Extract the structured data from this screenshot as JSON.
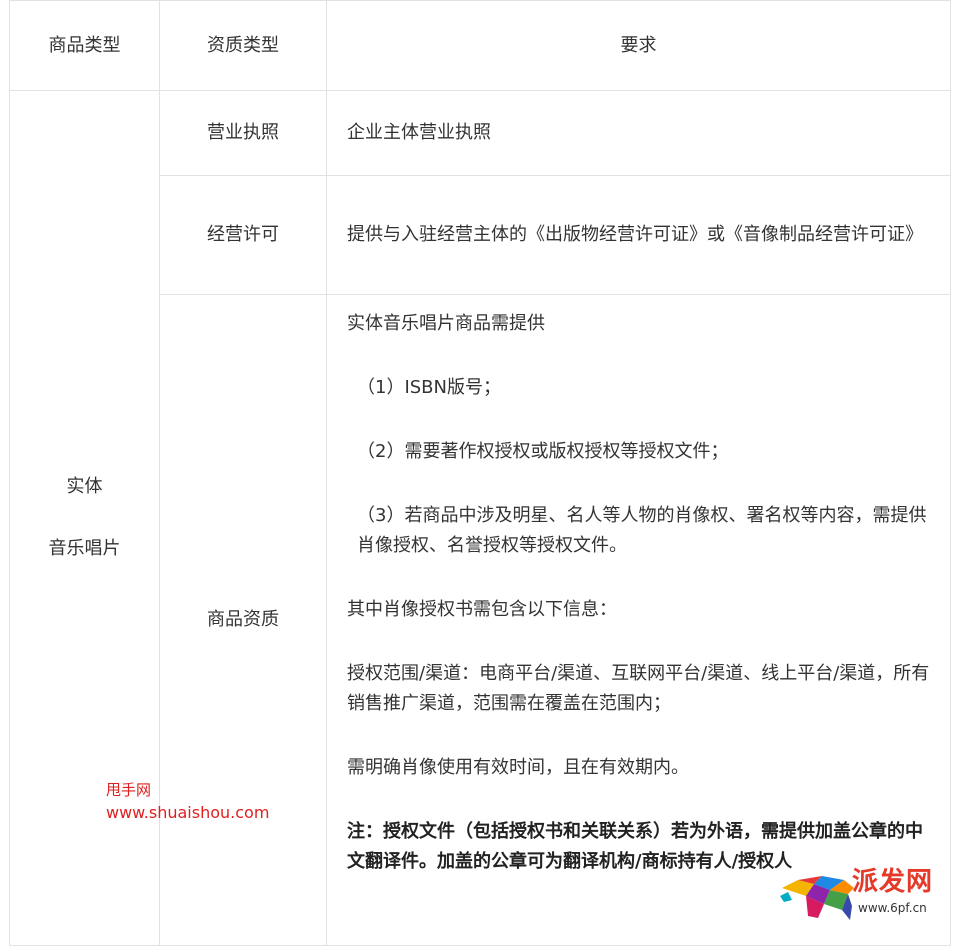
{
  "table": {
    "headers": [
      "商品类型",
      "资质类型",
      "要求"
    ],
    "category_line1": "实体",
    "category_line2": "音乐唱片",
    "rows": [
      {
        "type": "营业执照",
        "requirement": "企业主体营业执照"
      },
      {
        "type": "经营许可",
        "requirement": "提供与入驻经营主体的《出版物经营许可证》或《音像制品经营许可证》"
      },
      {
        "type": "商品资质",
        "paragraphs": [
          "实体音乐唱片商品需提供",
          "（1）ISBN版号；",
          "（2）需要著作权授权或版权授权等授权文件；",
          "（3）若商品中涉及明星、名人等人物的肖像权、署名权等内容，需提供肖像授权、名誉授权等授权文件。",
          "其中肖像授权书需包含以下信息：",
          "授权范围/渠道：电商平台/渠道、互联网平台/渠道、线上平台/渠道，所有销售推广渠道，范围需在覆盖在范围内；",
          "需明确肖像使用有效时间，且在有效期内。",
          "注：授权文件（包括授权书和关联关系）若为外语，需提供加盖公章的中文翻译件。加盖的公章可为翻译机构/商标持有人/授权人"
        ]
      }
    ]
  },
  "watermark": {
    "site_name": "甩手网",
    "site_url": "www.shuaishou.com",
    "color": "#e02020"
  },
  "logo": {
    "text": "派发网",
    "url": "www.6pf.cn",
    "icon": "colorful-bull-icon"
  }
}
